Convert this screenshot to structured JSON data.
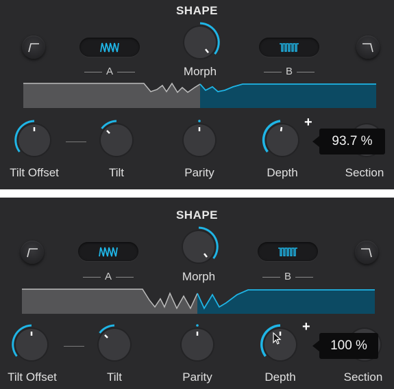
{
  "colors": {
    "accent": "#1fb5e6",
    "panel": "#2a2a2c",
    "wave_fill": "#5a5a5c"
  },
  "panels": [
    {
      "title": "SHAPE",
      "label_a": "A",
      "label_b": "B",
      "morph_label": "Morph",
      "knobs": [
        {
          "label": "Tilt Offset"
        },
        {
          "label": "Tilt"
        },
        {
          "label": "Parity"
        },
        {
          "label": "Depth"
        },
        {
          "label": "Section"
        }
      ],
      "tooltip": "93.7 %",
      "plus": "+",
      "icons": [
        "highpass-shape-icon",
        "saw-wave-icon",
        "square-wave-icon",
        "lowpass-shape-icon"
      ]
    },
    {
      "title": "SHAPE",
      "label_a": "A",
      "label_b": "B",
      "morph_label": "Morph",
      "knobs": [
        {
          "label": "Tilt Offset"
        },
        {
          "label": "Tilt"
        },
        {
          "label": "Parity"
        },
        {
          "label": "Depth"
        },
        {
          "label": "Section"
        }
      ],
      "tooltip": "100 %",
      "plus": "+",
      "icons": [
        "highpass-shape-icon",
        "saw-wave-icon",
        "square-wave-icon",
        "lowpass-shape-icon",
        "mouse-cursor-icon"
      ]
    }
  ]
}
